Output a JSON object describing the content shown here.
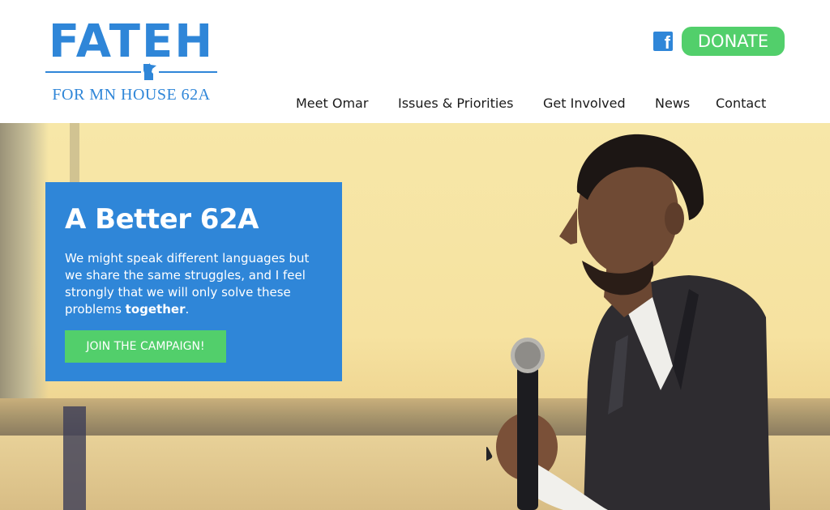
{
  "colors": {
    "brand_blue": "#2f86d8",
    "accent_green": "#52cf6b",
    "nav_text": "#1a1a1a",
    "white": "#ffffff"
  },
  "logo": {
    "title": "FATEH",
    "subtitle": "FOR MN HOUSE 62A",
    "state_icon": "minnesota-shape-icon"
  },
  "header": {
    "social_icon": "facebook-icon",
    "social_glyph": "f",
    "donate_label": "DONATE"
  },
  "nav": {
    "items": [
      {
        "label": "Meet Omar"
      },
      {
        "label": "Issues & Priorities"
      },
      {
        "label": "Get Involved"
      },
      {
        "label": "News"
      },
      {
        "label": "Contact"
      }
    ]
  },
  "hero": {
    "title": "A Better 62A",
    "text_before": "We might speak different languages but we share the same struggles, and I feel strongly that we will only solve these problems ",
    "text_emphasis": "together",
    "text_after": ".",
    "cta_label": "JOIN THE CAMPAIGN!",
    "photo_subject": "candidate-speaking-with-microphone"
  }
}
